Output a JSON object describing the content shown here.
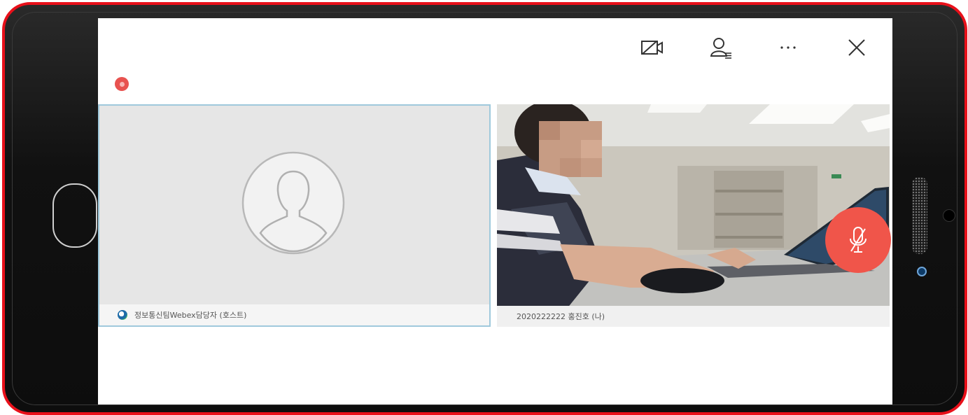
{
  "toolbar": {
    "icons": [
      "video-off-icon",
      "participants-icon",
      "more-icon",
      "close-icon"
    ]
  },
  "recording_indicator": "record-icon",
  "participants": [
    {
      "name": "정보통신팀Webex담당자 (호스트)",
      "video": false,
      "badge": "host-icon"
    },
    {
      "name": "2020222222 홍진호 (나)",
      "video": true,
      "muted": true
    }
  ],
  "colors": {
    "frame_highlight": "#e8101a",
    "mute_button": "#f0554a",
    "record_dot": "#e8524f",
    "active_speaker_border": "#9fc9dc"
  }
}
